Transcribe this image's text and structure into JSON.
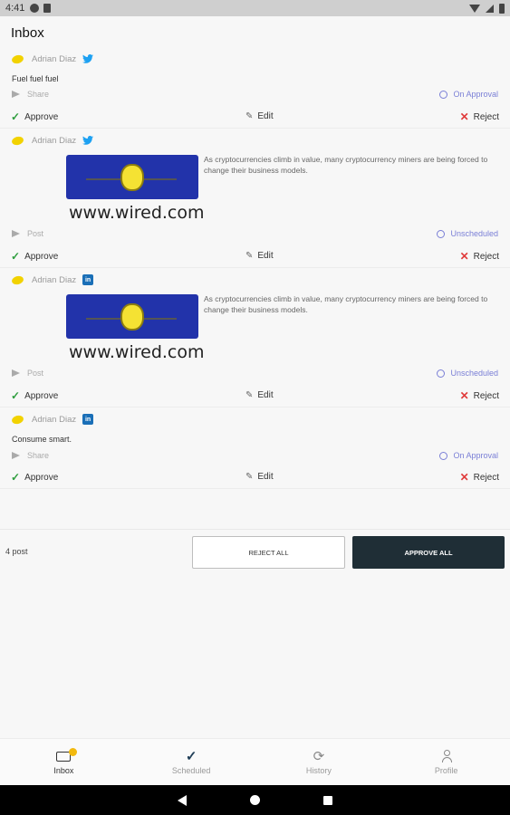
{
  "status_bar": {
    "time": "4:41"
  },
  "page_title": "Inbox",
  "posts": [
    {
      "author": "Adrian Diaz",
      "network": "twitter",
      "text": "Fuel fuel fuel",
      "post_type": "Share",
      "status": "On Approval"
    },
    {
      "author": "Adrian Diaz",
      "network": "twitter",
      "link_url": "www.wired.com",
      "link_description": "As cryptocurrencies climb in value, many cryptocurrency miners are being forced to change their business models.",
      "post_type": "Post",
      "status": "Unscheduled"
    },
    {
      "author": "Adrian Diaz",
      "network": "linkedin",
      "network_label": "in",
      "link_url": "www.wired.com",
      "link_description": "As cryptocurrencies climb in value, many cryptocurrency miners are being forced to change their business models.",
      "post_type": "Post",
      "status": "Unscheduled"
    },
    {
      "author": "Adrian Diaz",
      "network": "linkedin",
      "network_label": "in",
      "text": "Consume smart.",
      "post_type": "Share",
      "status": "On Approval"
    }
  ],
  "actions": {
    "approve": "Approve",
    "edit": "Edit",
    "reject": "Reject"
  },
  "footer": {
    "post_count": "4  post",
    "reject_all": "REJECT ALL",
    "approve_all": "APPROVE ALL"
  },
  "tabs": [
    {
      "label": "Inbox",
      "icon": "inbox-icon",
      "active": true
    },
    {
      "label": "Scheduled",
      "icon": "check-icon"
    },
    {
      "label": "History",
      "icon": "refresh-icon"
    },
    {
      "label": "Profile",
      "icon": "person-icon"
    }
  ],
  "colors": {
    "approve": "#2e9e3e",
    "reject": "#e03b3b",
    "status": "#7a7fd6",
    "primary_button": "#1f2e36"
  }
}
